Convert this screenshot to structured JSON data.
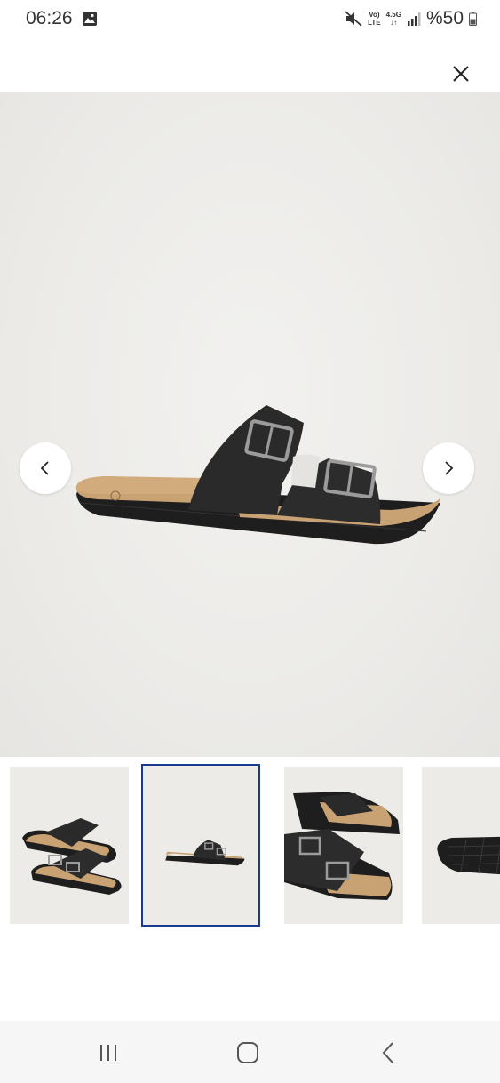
{
  "status_bar": {
    "time": "06:26",
    "network_top": "Vo)",
    "network_mid": "LTE",
    "network_type": "4.5G",
    "battery_text": "%50",
    "icons": [
      "gallery-icon",
      "mute-icon",
      "signal-icon",
      "battery-icon"
    ]
  },
  "viewer": {
    "close_icon": "close-icon",
    "prev_icon": "chevron-left-icon",
    "next_icon": "chevron-right-icon",
    "main_image": "black two-buckle slide sandal, side view",
    "active_thumbnail": 2
  },
  "thumbnails": [
    {
      "view": "pair, top angle"
    },
    {
      "view": "single, side view"
    },
    {
      "view": "pair, close-up buckles"
    },
    {
      "view": "sole detail"
    }
  ],
  "system_nav": {
    "icons": [
      "recent-apps-icon",
      "home-icon",
      "back-icon"
    ]
  },
  "colors": {
    "background": "#ffffff",
    "image_bg": "#ecebe8",
    "active_border": "#1a3a8f",
    "sandal_upper": "#2a2a2a",
    "footbed": "#c9a273"
  }
}
